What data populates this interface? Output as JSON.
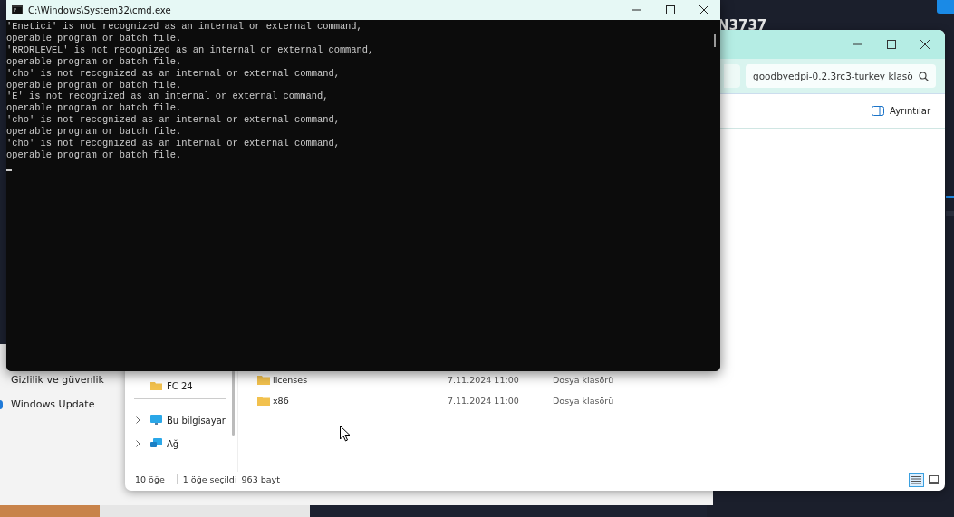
{
  "background_app": {
    "texts": [
      "N3737"
    ]
  },
  "settings": {
    "items": [
      {
        "label": "Gizlilik ve güvenlik"
      },
      {
        "label": "Windows Update"
      }
    ]
  },
  "explorer": {
    "search": {
      "value": "goodbyedpi-0.2.3rc3-turkey klasö"
    },
    "details_button": "Ayrıntılar",
    "quick_access": [
      {
        "label": "FC 24"
      }
    ],
    "locations": [
      {
        "label": "Bu bilgisayar",
        "kind": "pc"
      },
      {
        "label": "Ağ",
        "kind": "network"
      }
    ],
    "files": [
      {
        "name": "licenses",
        "date": "7.11.2024 11:00",
        "type": "Dosya klasörü"
      },
      {
        "name": "x86",
        "date": "7.11.2024 11:00",
        "type": "Dosya klasörü"
      }
    ],
    "status_bar": [
      "10 öğe",
      "1 öğe seçildi",
      "963 bayt"
    ],
    "views": [
      {
        "kind": "details",
        "selected": true
      },
      {
        "kind": "tiles",
        "selected": false
      }
    ]
  },
  "cmd": {
    "title": "C:\\Windows\\System32\\cmd.exe",
    "cursor": true,
    "lines": [
      "'Enetici' is not recognized as an internal or external command,",
      "operable program or batch file.",
      "'RRORLEVEL' is not recognized as an internal or external command,",
      "operable program or batch file.",
      "'cho' is not recognized as an internal or external command,",
      "operable program or batch file.",
      "'E' is not recognized as an internal or external command,",
      "operable program or batch file.",
      "'cho' is not recognized as an internal or external command,",
      "operable program or batch file.",
      "'cho' is not recognized as an internal or external command,",
      "operable program or batch file."
    ]
  }
}
